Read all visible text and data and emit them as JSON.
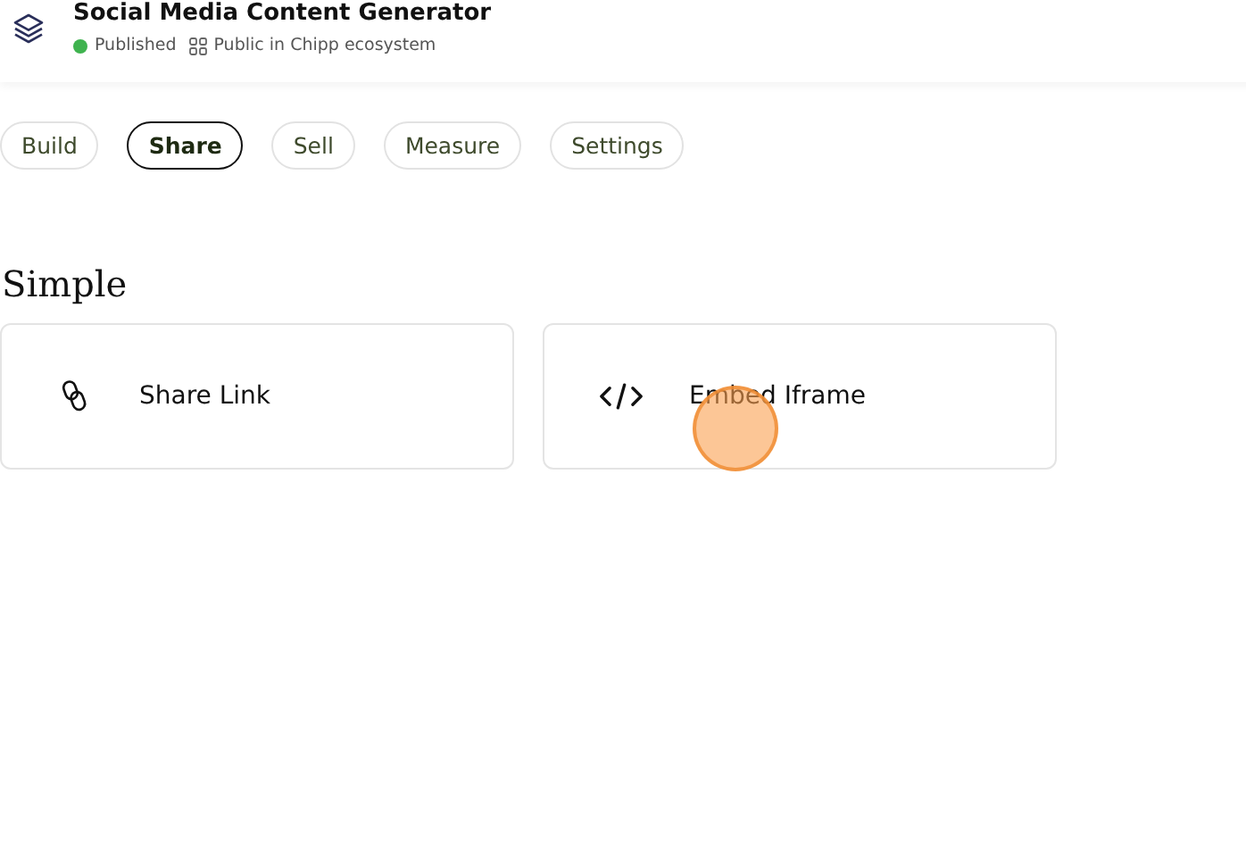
{
  "app": {
    "title": "Social Media Content Generator",
    "status": {
      "label": "Published",
      "color": "#3fb34f"
    },
    "visibility": "Public in Chipp ecosystem"
  },
  "tabs": [
    {
      "label": "Build",
      "selected": false
    },
    {
      "label": "Share",
      "selected": true
    },
    {
      "label": "Sell",
      "selected": false
    },
    {
      "label": "Measure",
      "selected": false
    },
    {
      "label": "Settings",
      "selected": false
    }
  ],
  "section": {
    "title": "Simple",
    "options": [
      {
        "kind": "link",
        "label": "Share Link"
      },
      {
        "kind": "embed",
        "label": "Embed Iframe"
      }
    ]
  }
}
